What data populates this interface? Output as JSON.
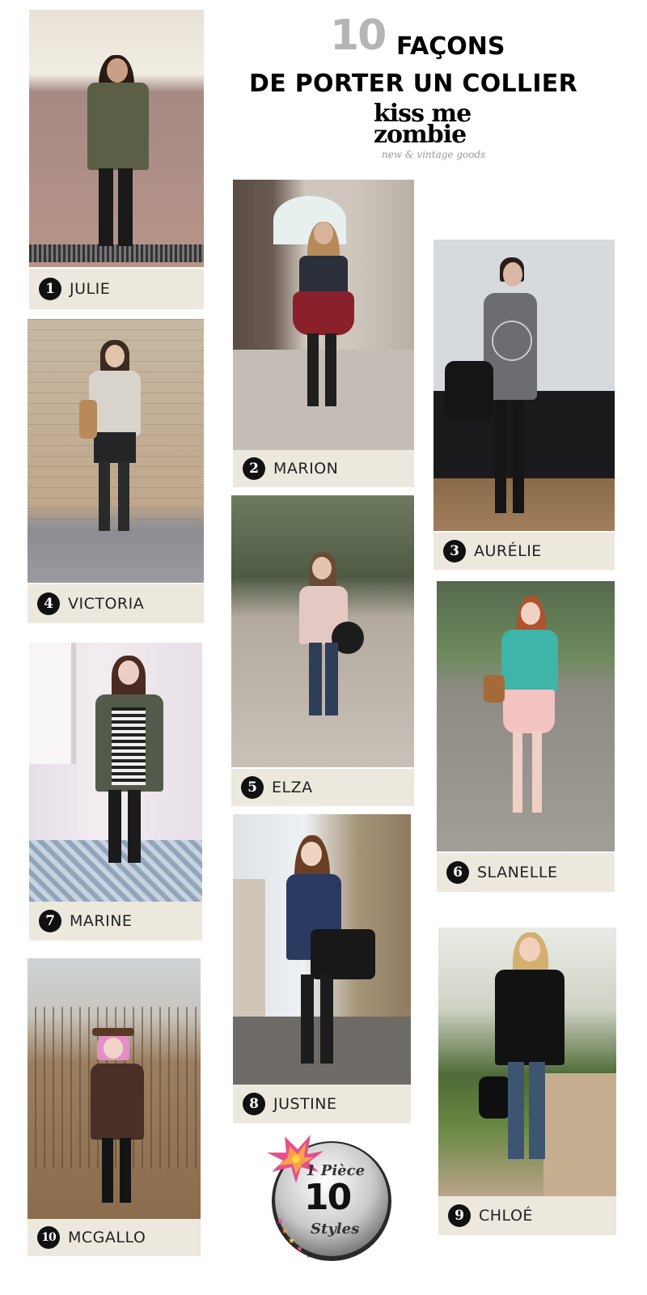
{
  "title": {
    "number": "10",
    "line1": "FAÇONS",
    "line2": "DE PORTER UN COLLIER",
    "brand_top": "kiss me",
    "brand_bottom": "zombie",
    "brand_tagline": "new & vintage goods"
  },
  "looks": [
    {
      "number": "1",
      "name": "JULIE"
    },
    {
      "number": "2",
      "name": "MARION"
    },
    {
      "number": "3",
      "name": "AURÉLIE"
    },
    {
      "number": "4",
      "name": "VICTORIA"
    },
    {
      "number": "5",
      "name": "ELZA"
    },
    {
      "number": "6",
      "name": "SLANELLE"
    },
    {
      "number": "7",
      "name": "MARINE"
    },
    {
      "number": "8",
      "name": "JUSTINE"
    },
    {
      "number": "9",
      "name": "CHLOÉ"
    },
    {
      "number": "10",
      "name": "MCGALLO"
    }
  ],
  "badge": {
    "line1": "1 Pièce",
    "line2": "10",
    "line3": "Styles"
  }
}
